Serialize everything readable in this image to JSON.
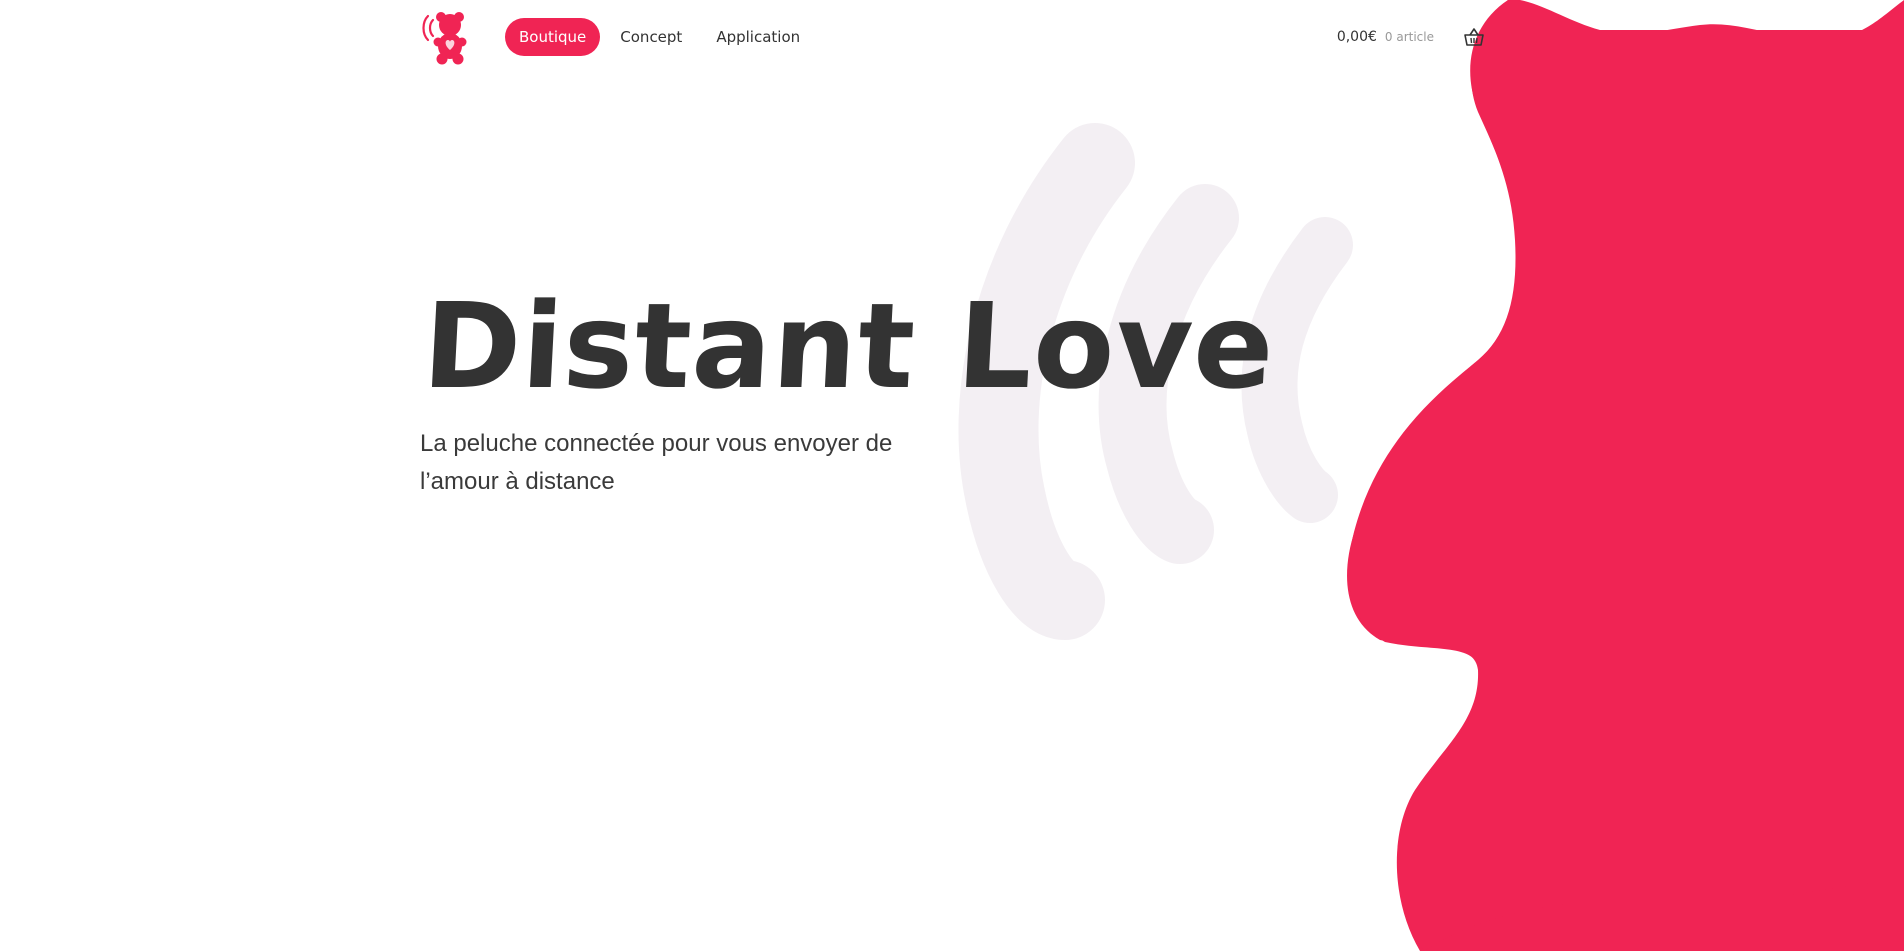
{
  "colors": {
    "accent": "#f02454",
    "text": "#333333",
    "muted": "#999999",
    "wave": "#f3eff3",
    "background": "#ffffff"
  },
  "header": {
    "logo_icon": "teddy-bear-signal-icon",
    "nav": [
      {
        "label": "Boutique",
        "active": true
      },
      {
        "label": "Concept",
        "active": false
      },
      {
        "label": "Application",
        "active": false
      }
    ],
    "cart": {
      "total": "0,00€",
      "count": "0 article",
      "icon": "shopping-basket-icon"
    }
  },
  "hero": {
    "title": "Distant Love",
    "subtitle": "La peluche connectée pour vous envoyer de l’amour à distance"
  },
  "decor": {
    "blob": "teddy-bear-silhouette",
    "waves": "signal-waves"
  }
}
